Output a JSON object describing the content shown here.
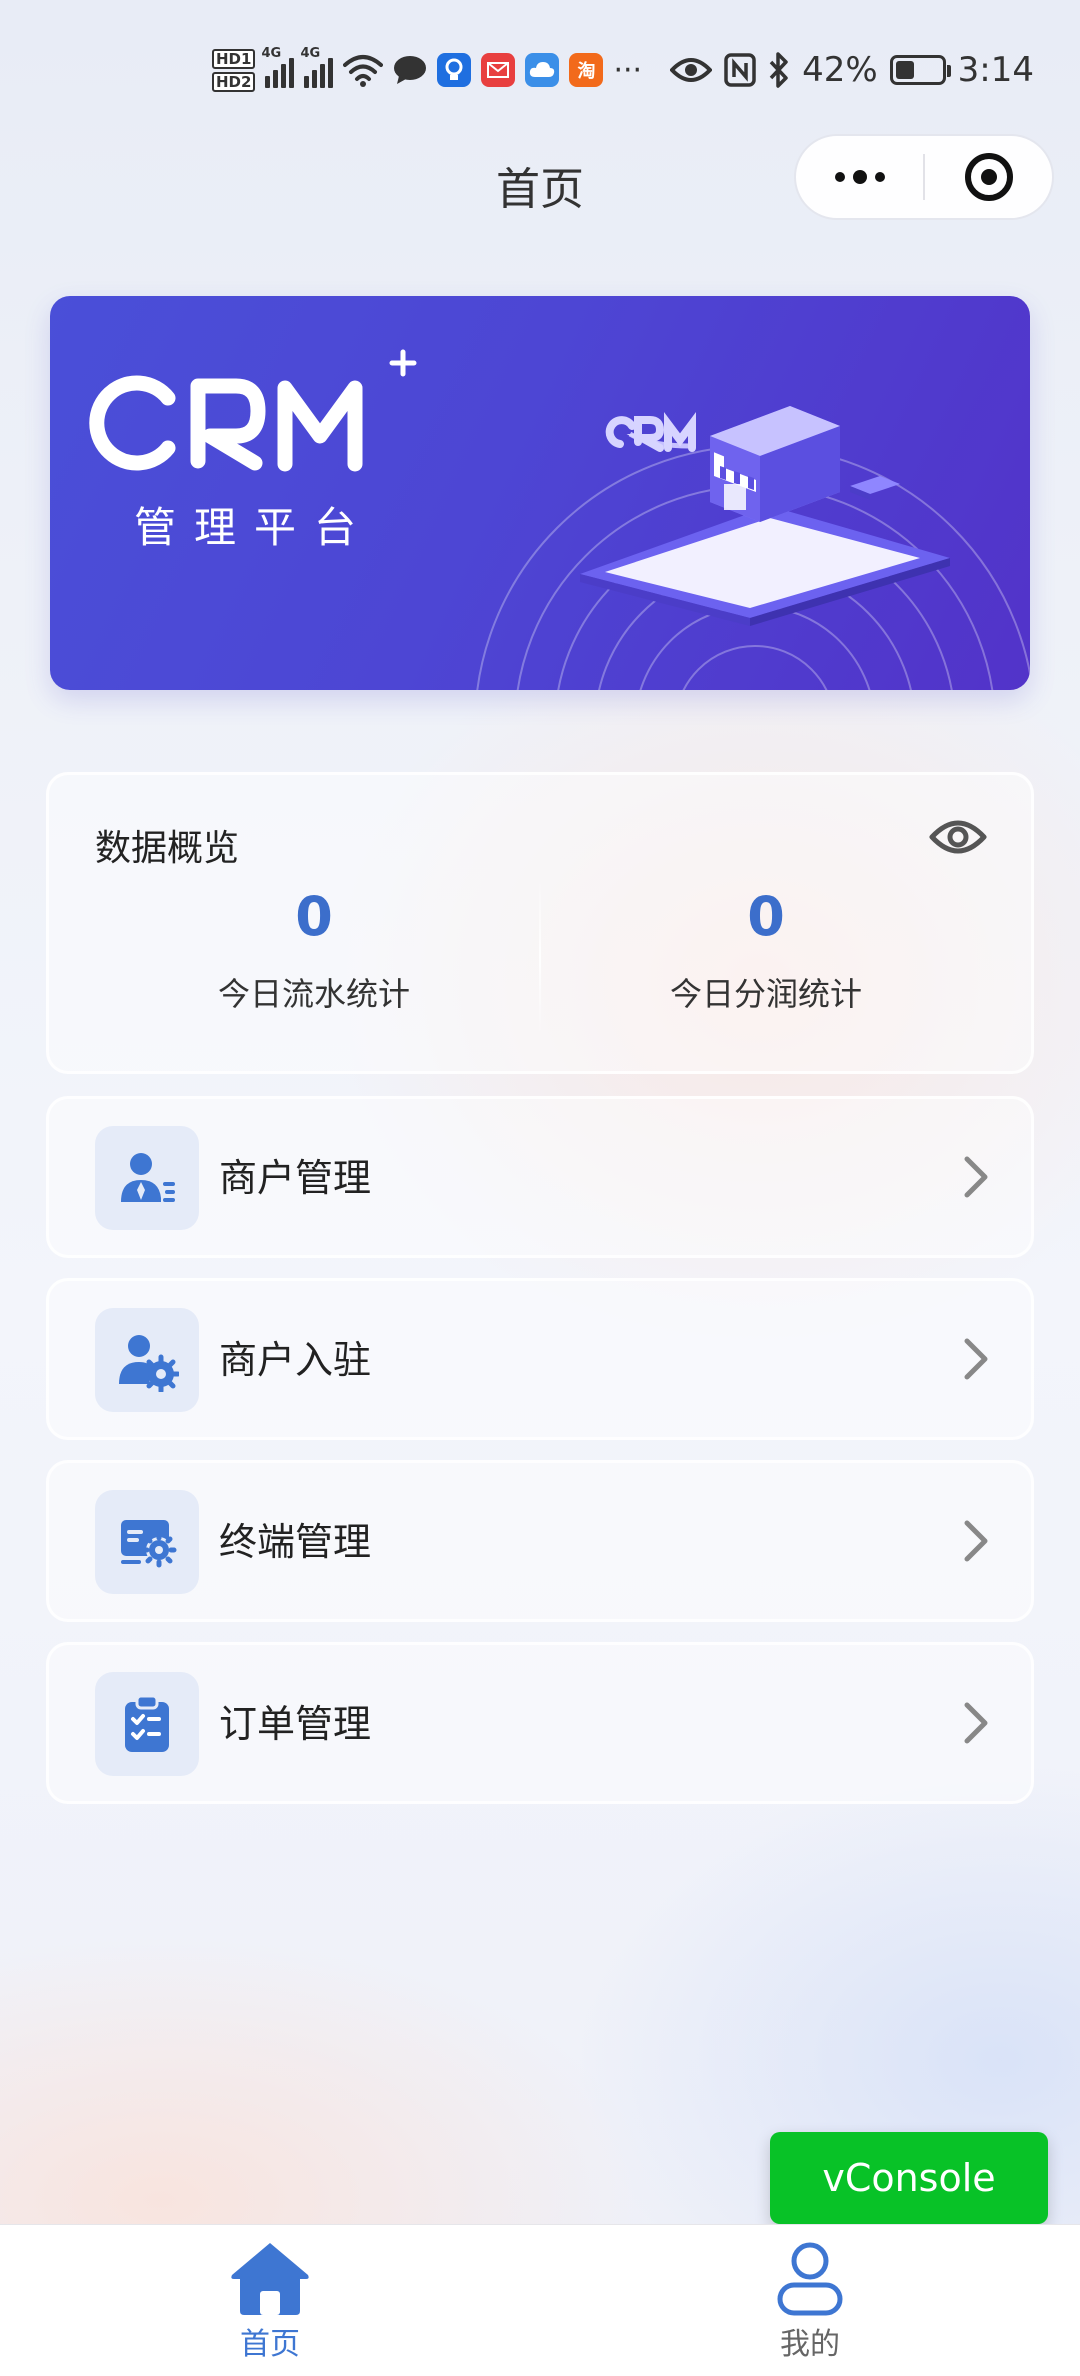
{
  "status_bar": {
    "net1": "4G",
    "net2": "4G",
    "more": "···",
    "battery_text": "42%",
    "battery_level": 0.42,
    "time": "3:14",
    "app_icon_taobao": "淘"
  },
  "nav": {
    "title": "首页",
    "more_icon": "more-dots-icon",
    "close_icon": "target-close-icon"
  },
  "banner": {
    "logo_text": "CRM",
    "subtitle": "管理平台"
  },
  "overview": {
    "title": "数据概览",
    "today_flow_value": "0",
    "today_flow_label": "今日流水统计",
    "today_profit_value": "0",
    "today_profit_label": "今日分润统计"
  },
  "menu": [
    {
      "label": "商户管理",
      "icon": "merchant-user-icon"
    },
    {
      "label": "商户入驻",
      "icon": "merchant-settings-icon"
    },
    {
      "label": "终端管理",
      "icon": "terminal-settings-icon"
    },
    {
      "label": "订单管理",
      "icon": "order-clipboard-icon"
    }
  ],
  "vconsole": {
    "label": "vConsole"
  },
  "tabbar": {
    "home_label": "首页",
    "mine_label": "我的",
    "active_color": "#3e76d2"
  }
}
